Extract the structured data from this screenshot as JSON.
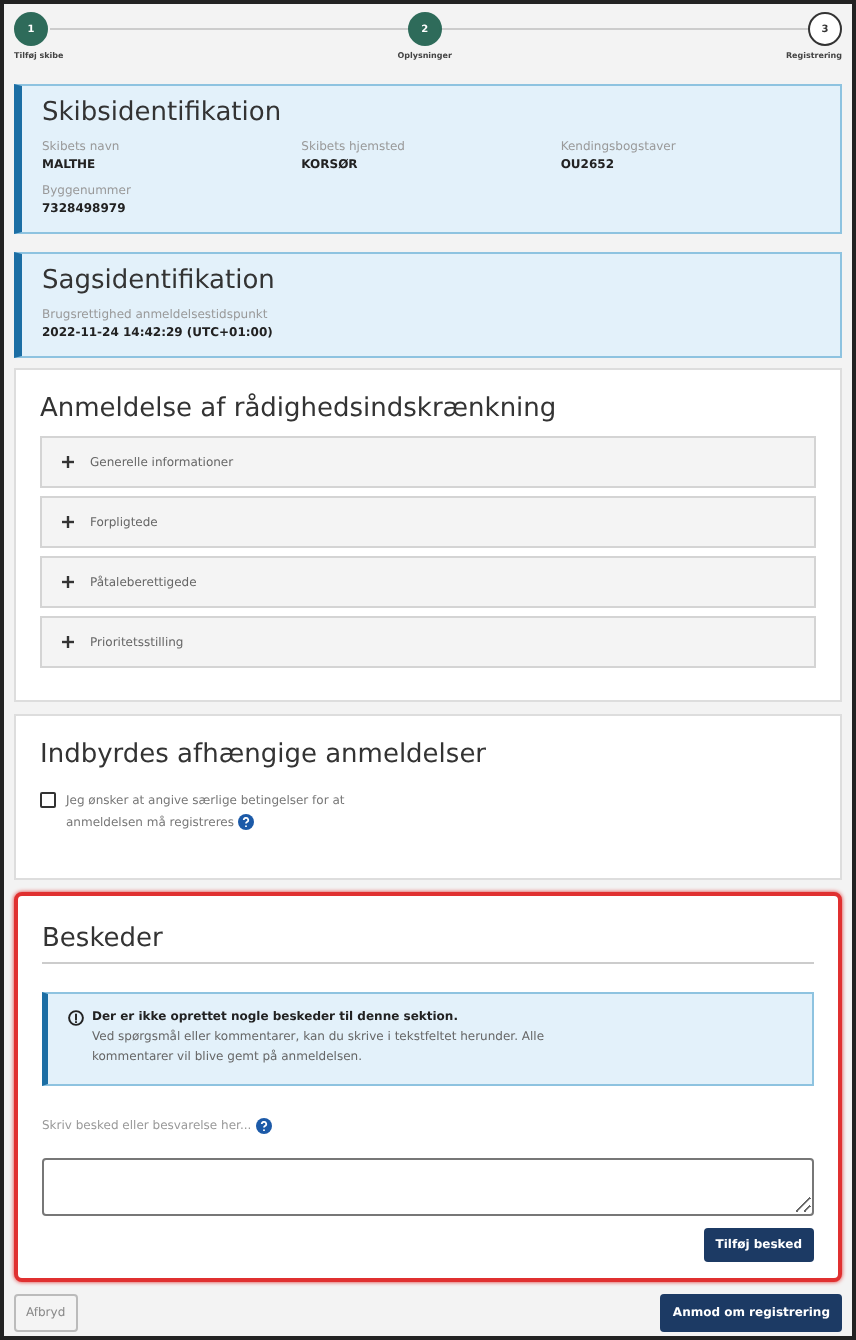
{
  "steps": [
    {
      "number": "1",
      "label": "Tilføj skibe",
      "completed": true
    },
    {
      "number": "2",
      "label": "Oplysninger",
      "completed": true
    },
    {
      "number": "3",
      "label": "Registrering",
      "completed": false
    }
  ],
  "ship_card": {
    "title": "Skibsidentifikation",
    "fields": [
      {
        "label": "Skibets navn",
        "value": "MALTHE"
      },
      {
        "label": "Skibets hjemsted",
        "value": "KORSØR"
      },
      {
        "label": "Kendingsbogstaver",
        "value": "OU2652"
      },
      {
        "label": "Byggenummer",
        "value": "7328498979"
      }
    ]
  },
  "case_card": {
    "title": "Sagsidentifikation",
    "fields": [
      {
        "label": "Brugsrettighed anmeldelsestidspunkt",
        "value": "2022-11-24 14:42:29 (UTC+01:00)"
      }
    ]
  },
  "declaration": {
    "title": "Anmeldelse af rådighedsindskrænkning",
    "sections": [
      {
        "label": "Generelle informationer",
        "expanded": false
      },
      {
        "label": "Forpligtede",
        "expanded": false
      },
      {
        "label": "Påtaleberettigede",
        "expanded": false
      },
      {
        "label": "Prioritetsstilling",
        "expanded": false
      }
    ]
  },
  "dependent": {
    "title": "Indbyrdes afhængige anmeldelser",
    "checkbox": {
      "label": "Jeg ønsker at angive særlige betingelser for at anmeldelsen må registreres",
      "checked": false
    }
  },
  "messages": {
    "title": "Beskeder",
    "highlighted": true,
    "info": {
      "heading": "Der er ikke oprettet nogle beskeder til denne sektion.",
      "text": "Ved spørgsmål eller kommentarer, kan du skrive i tekstfeltet herunder. Alle kommentarer vil blive gemt på anmeldelsen."
    },
    "field_label": "Skriv besked eller besvarelse her...",
    "button": "Tilføj besked"
  },
  "footer": {
    "cancel": "Afbryd",
    "submit": "Anmod om registrering"
  }
}
